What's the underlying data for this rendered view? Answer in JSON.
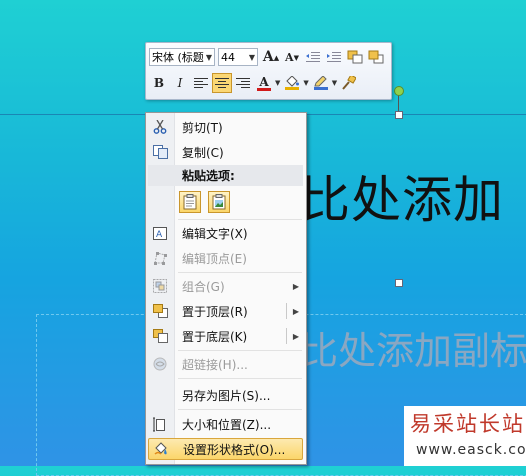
{
  "slide": {
    "title_placeholder": "比处添加",
    "subtitle_placeholder": "比处添加副标"
  },
  "mini_toolbar": {
    "font_name": "宋体 (标题",
    "font_size": "44",
    "grow_font_glyph": "A",
    "shrink_font_glyph": "A",
    "bold_glyph": "B",
    "italic_glyph": "I",
    "font_color_glyph": "A",
    "colors": {
      "font_color": "#d11a1a",
      "fill_color": "#e8b000",
      "line_color": "#3a6fd0"
    }
  },
  "context_menu": {
    "cut": "剪切(T)",
    "copy": "复制(C)",
    "paste_options_header": "粘贴选项:",
    "edit_text": "编辑文字(X)",
    "edit_points": "编辑顶点(E)",
    "group": "组合(G)",
    "bring_to_front": "置于顶层(R)",
    "send_to_back": "置于底层(K)",
    "hyperlink": "超链接(H)...",
    "save_as_picture": "另存为图片(S)...",
    "size_and_position": "大小和位置(Z)...",
    "format_shape": "设置形状格式(O)..."
  },
  "watermark": {
    "logo": "易采站长站",
    "url": "www.easck.com"
  },
  "icons": {
    "cut": "scissors-icon",
    "copy": "copy-icon",
    "paste": "paste-icon",
    "edit_text": "edit-text-icon",
    "edit_points": "edit-points-icon",
    "group": "group-icon",
    "bring_front": "bring-front-icon",
    "send_back": "send-back-icon",
    "hyperlink": "hyperlink-icon",
    "size_position": "size-position-icon",
    "format_shape": "format-shape-icon"
  }
}
